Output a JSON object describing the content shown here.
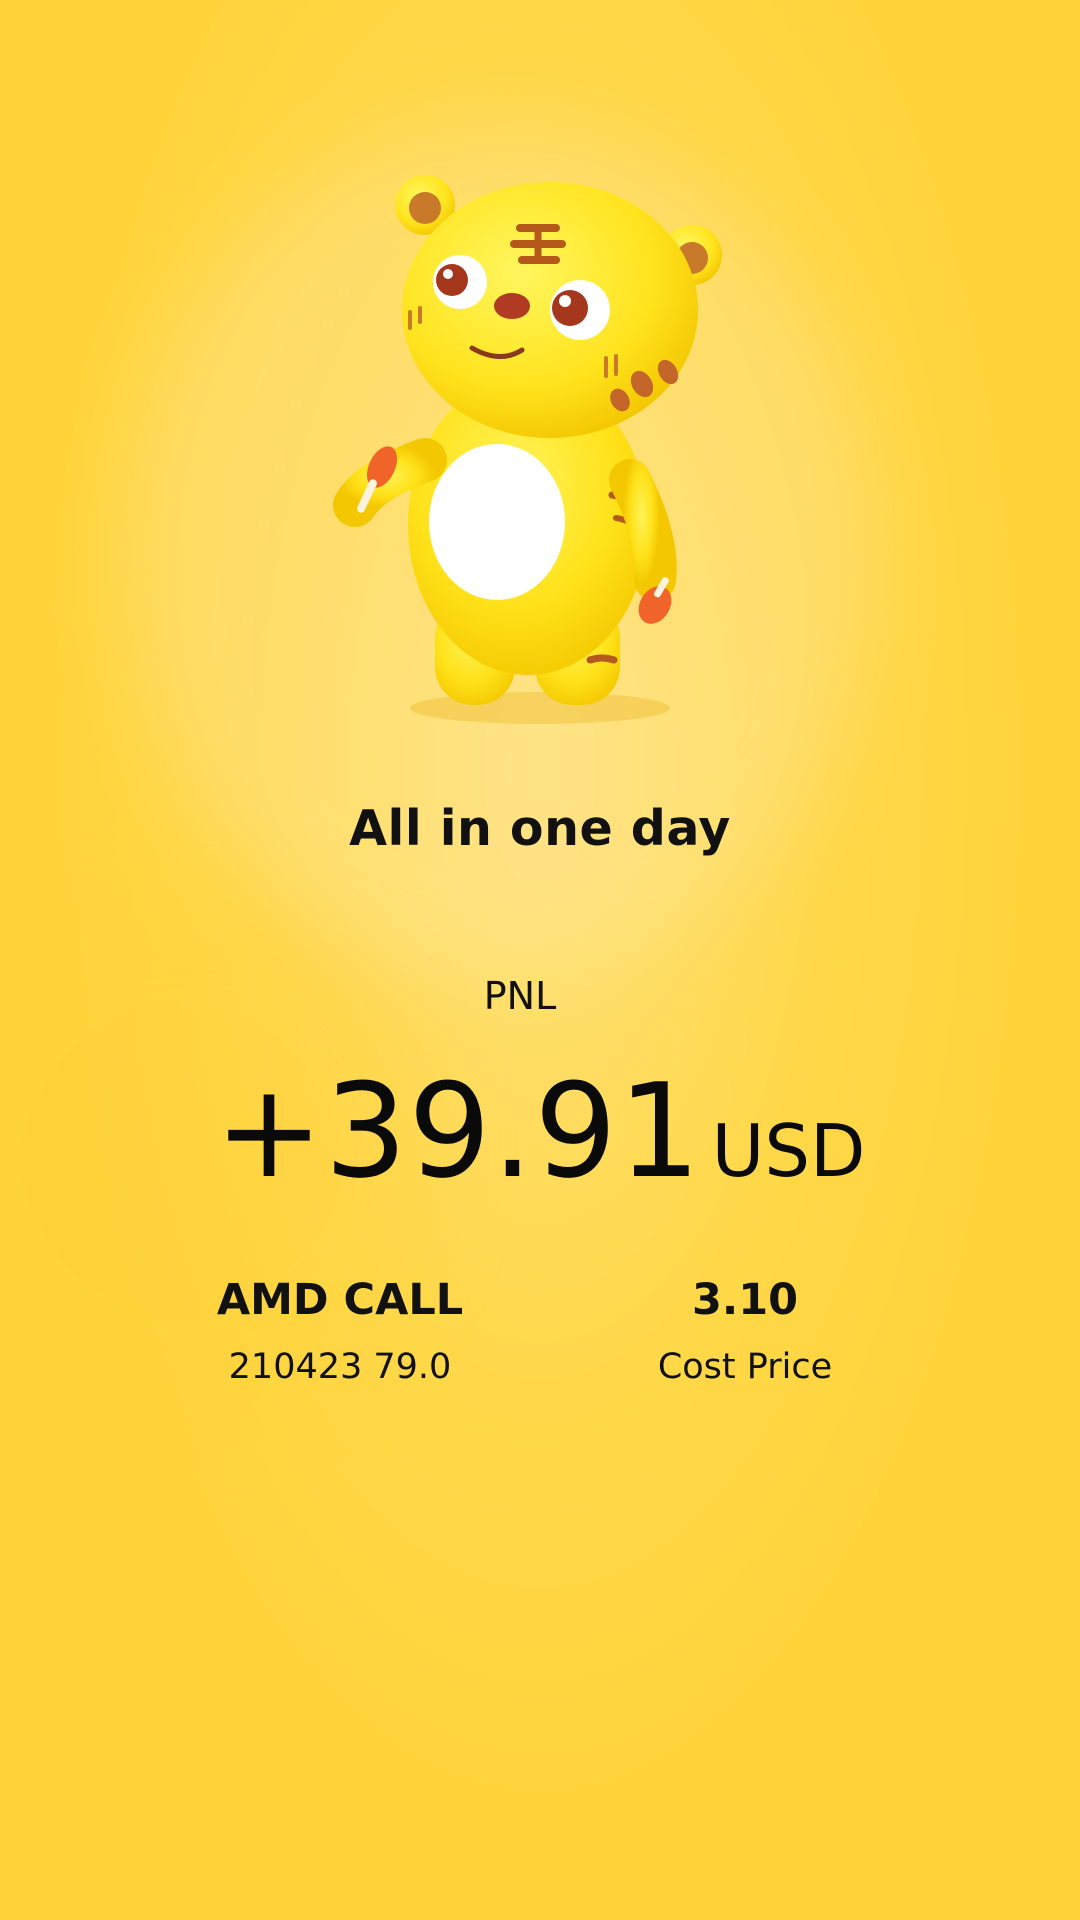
{
  "headline": "All in one day",
  "pnl": {
    "label": "PNL",
    "value": "+39.91",
    "unit": "USD"
  },
  "position": {
    "name": "AMD CALL",
    "contract": "210423 79.0"
  },
  "cost": {
    "value": "3.10",
    "label": "Cost Price"
  },
  "colors": {
    "background": "#ffd43a",
    "text": "#111111",
    "mascot_body": "#ffe21a",
    "mascot_belly": "#ffffff",
    "mascot_stripes": "#b5581c"
  },
  "illustration": "tiger-mascot-holding-drumsticks"
}
